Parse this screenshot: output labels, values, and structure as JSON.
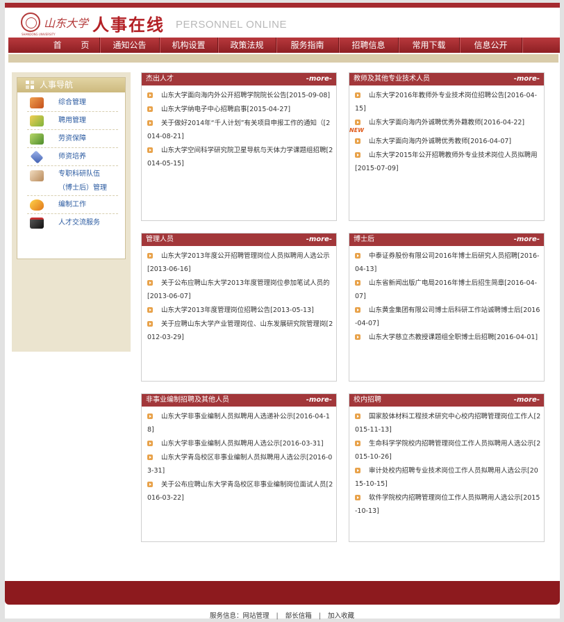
{
  "header": {
    "university_name": "山东大学",
    "university_sub": "SHANDONG UNIVERSITY",
    "site_title": "人事在线",
    "site_title_en": "PERSONNEL ONLINE"
  },
  "nav": {
    "items": [
      "首 页",
      "通知公告",
      "机构设置",
      "政策法规",
      "服务指南",
      "招聘信息",
      "常用下载",
      "信息公开"
    ]
  },
  "sidebar": {
    "title": "人事导航",
    "items": [
      {
        "label": "综合管理",
        "icon": "gear-coins-icon",
        "color": "#d86a2a"
      },
      {
        "label": "聘用管理",
        "icon": "people-icon",
        "color": "#d7a12a"
      },
      {
        "label": "劳资保障",
        "icon": "pen-icon",
        "color": "#6aa83a"
      },
      {
        "label": "师资培养",
        "icon": "diamond-icon",
        "color": "#5b7cc8"
      },
      {
        "label": "专职科研队伍",
        "label2": "（博士后）管理",
        "icon": "book-icon",
        "color": "#c9a07a"
      },
      {
        "label": "编制工作",
        "icon": "heart-icon",
        "color": "#e8a020"
      },
      {
        "label": "人才交流服务",
        "icon": "briefcase-icon",
        "color": "#2a2a2a"
      }
    ]
  },
  "panels": [
    {
      "title": "杰出人才",
      "more": "-more-",
      "items": [
        {
          "text": "山东大学面向海内外公开招聘学院院长公告[2015-09-08]"
        },
        {
          "text": "山东大学纳电子中心招聘启事[2015-04-27]"
        },
        {
          "text": "关于做好2014年“千人计划”有关项目申报工作的通知（[2014-08-21]"
        },
        {
          "text": "山东大学空间科学研究院卫星导航与天体力学课题组招聘[2014-05-15]"
        }
      ]
    },
    {
      "title": "教师及其他专业技术人员",
      "more": "-more-",
      "items": [
        {
          "text": "山东大学2016年教师外专业技术岗位招聘公告[2016-04-15]"
        },
        {
          "text": "山东大学面向海内外诚聘优秀外籍教师[2016-04-22]",
          "tag": "NEW"
        },
        {
          "text": "山东大学面向海内外诚聘优秀教师[2016-04-07]"
        },
        {
          "text": "山东大学2015年公开招聘教师外专业技术岗位人员拟聘用[2015-07-09]"
        }
      ]
    },
    {
      "title": "管理人员",
      "more": "-more-",
      "items": [
        {
          "text": "山东大学2013年度公开招聘管理岗位人员拟聘用人选公示[2013-06-16]"
        },
        {
          "text": "关于公布应聘山东大学2013年度管理岗位参加笔试人员的[2013-06-07]"
        },
        {
          "text": "山东大学2013年度管理岗位招聘公告[2013-05-13]"
        },
        {
          "text": "关于应聘山东大学产业管理岗位、山东发展研究院管理岗[2012-03-29]"
        }
      ]
    },
    {
      "title": "博士后",
      "more": "-more-",
      "items": [
        {
          "text": "中泰证券股份有限公司2016年博士后研究人员招聘[2016-04-13]"
        },
        {
          "text": "山东省新闻出版广电局2016年博士后招生简章[2016-04-07]"
        },
        {
          "text": "山东黄金集团有限公司博士后科研工作站诚聘博士后[2016-04-07]"
        },
        {
          "text": "山东大学慈立杰教授课题组全职博士后招聘[2016-04-01]"
        }
      ]
    },
    {
      "title": "非事业编制招聘及其他人员",
      "more": "-more-",
      "items": [
        {
          "text": "山东大学非事业编制人员拟聘用人选递补公示[2016-04-18]"
        },
        {
          "text": "山东大学非事业编制人员拟聘用人选公示[2016-03-31]"
        },
        {
          "text": "山东大学青岛校区非事业编制人员拟聘用人选公示[2016-03-31]"
        },
        {
          "text": "关于公布应聘山东大学青岛校区非事业编制岗位面试人员[2016-03-22]"
        }
      ]
    },
    {
      "title": "校内招聘",
      "more": "-more-",
      "items": [
        {
          "text": "国家胶体材料工程技术研究中心校内招聘管理岗位工作人[2015-11-13]"
        },
        {
          "text": "生命科学学院校内招聘管理岗位工作人员拟聘用人选公示[2015-10-26]"
        },
        {
          "text": "审计处校内招聘专业技术岗位工作人员拟聘用人选公示[2015-10-15]"
        },
        {
          "text": "软件学院校内招聘管理岗位工作人员拟聘用人选公示[2015-10-13]"
        }
      ]
    }
  ],
  "footer": {
    "links": [
      "服务信息：网站管理",
      "部长信箱",
      "加入收藏"
    ]
  },
  "colors": {
    "brand_red": "#a2373a",
    "nav_red": "#8e1f23",
    "sand": "#d9ccaa"
  }
}
